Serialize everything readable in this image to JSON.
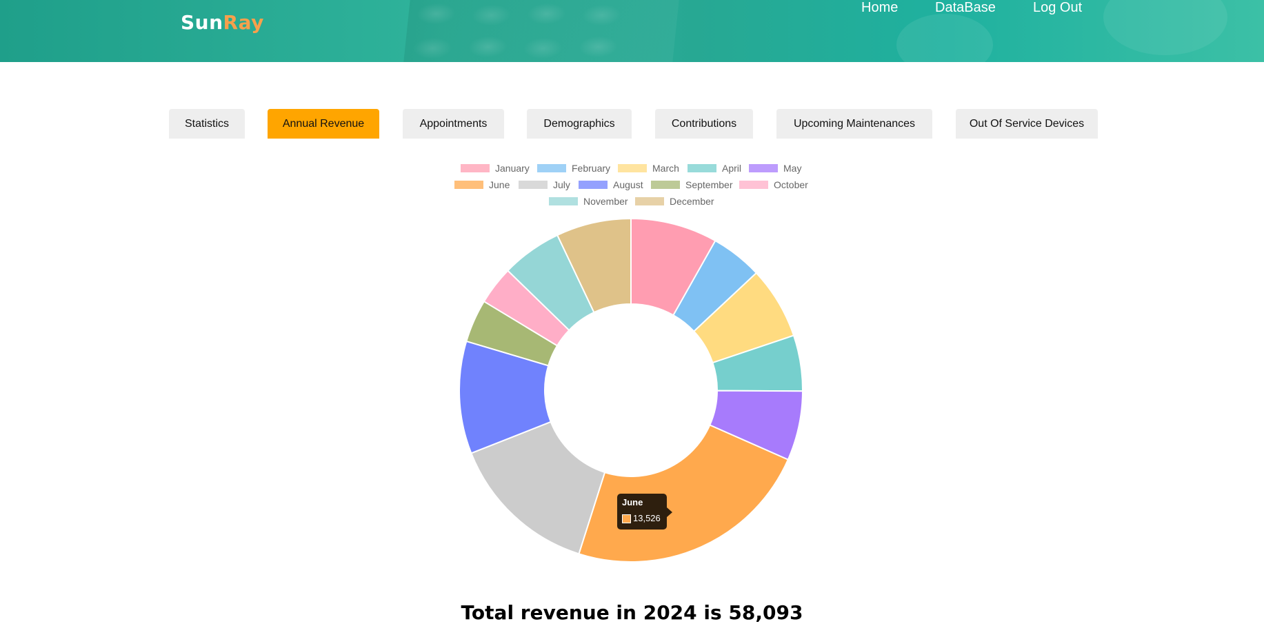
{
  "app": {
    "logo_part1": "Sun",
    "logo_part2": "Ray",
    "brand_color": "#f7a04c",
    "header_color": "#1fa98f"
  },
  "nav": {
    "home": "Home",
    "database": "DataBase",
    "logout": "Log Out"
  },
  "tabs": [
    {
      "label": "Statistics",
      "active": false
    },
    {
      "label": "Annual Revenue",
      "active": true
    },
    {
      "label": "Appointments",
      "active": false
    },
    {
      "label": "Demographics",
      "active": false
    },
    {
      "label": "Contributions",
      "active": false
    },
    {
      "label": "Upcoming Maintenances",
      "active": false
    },
    {
      "label": "Out Of Service Devices",
      "active": false
    }
  ],
  "accent_color": "#ffa500",
  "chart_data": {
    "type": "pie",
    "variant": "doughnut",
    "legend_position": "top",
    "categories": [
      "January",
      "February",
      "March",
      "April",
      "May",
      "June",
      "July",
      "August",
      "September",
      "October",
      "November",
      "December"
    ],
    "values": [
      4750,
      2820,
      3950,
      3050,
      3800,
      13526,
      8200,
      6150,
      2350,
      2100,
      3300,
      4097
    ],
    "colors": [
      "#ff9db1",
      "#7fc1f3",
      "#ffdb80",
      "#76cfcd",
      "#a77bfc",
      "#ffa94d",
      "#cccccc",
      "#7082fd",
      "#a7b874",
      "#ffaec7",
      "#95d6d6",
      "#dfc289"
    ],
    "tooltip": {
      "label": "June",
      "value": "13,526"
    }
  },
  "summary": {
    "total_text": "Total revenue in 2024 is 58,093"
  }
}
